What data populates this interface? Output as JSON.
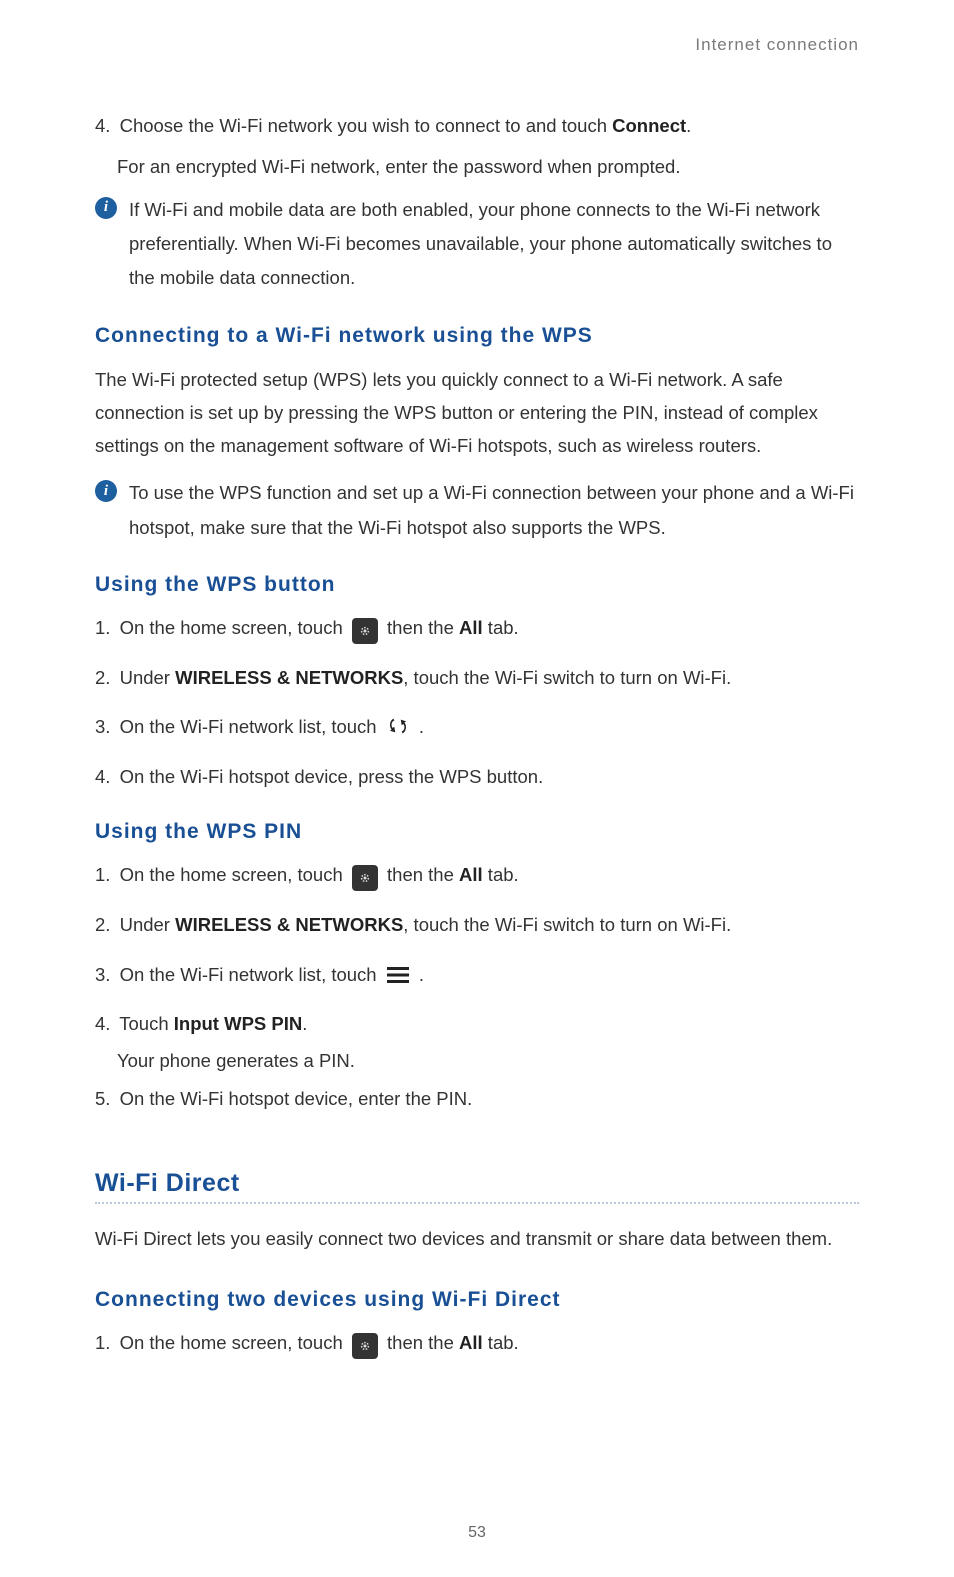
{
  "header": {
    "title": "Internet connection"
  },
  "intro": {
    "step4_num": "4.",
    "step4_text_a": "Choose the Wi-Fi network you wish to connect to and touch ",
    "step4_bold": "Connect",
    "step4_text_b": ".",
    "step4_sub": "For an encrypted Wi-Fi network, enter the password when prompted.",
    "info_text": "If Wi-Fi and mobile data are both enabled, your phone connects to the Wi-Fi network preferentially. When Wi-Fi becomes unavailable, your phone automatically switches to the mobile data connection."
  },
  "wps_connect": {
    "title": "Connecting to a Wi-Fi network using the WPS",
    "para": "The Wi-Fi protected setup (WPS) lets you quickly connect to a Wi-Fi network. A safe connection is set up by pressing the WPS button or entering the PIN, instead of complex settings on the management software of Wi-Fi hotspots, such as wireless routers.",
    "info_text": "To use the WPS function and set up a Wi-Fi connection between your phone and a Wi-Fi hotspot, make sure that the Wi-Fi hotspot also supports the WPS."
  },
  "wps_button": {
    "title": "Using the WPS button",
    "s1_num": "1.",
    "s1_a": "On the home screen, touch ",
    "s1_b": " then the ",
    "s1_bold": "All",
    "s1_c": " tab.",
    "s2_num": "2.",
    "s2_a": "Under ",
    "s2_bold": "WIRELESS & NETWORKS",
    "s2_b": ", touch the Wi-Fi switch to turn on Wi-Fi.",
    "s3_num": "3.",
    "s3_a": "On the Wi-Fi network list, touch ",
    "s3_b": " .",
    "s4_num": "4.",
    "s4_a": "On the Wi-Fi hotspot device, press the WPS button."
  },
  "wps_pin": {
    "title": "Using the WPS PIN",
    "s1_num": "1.",
    "s1_a": "On the home screen, touch ",
    "s1_b": " then the ",
    "s1_bold": "All",
    "s1_c": " tab.",
    "s2_num": "2.",
    "s2_a": "Under ",
    "s2_bold": "WIRELESS & NETWORKS",
    "s2_b": ", touch the Wi-Fi switch to turn on Wi-Fi.",
    "s3_num": "3.",
    "s3_a": "On the Wi-Fi network list, touch ",
    "s3_b": " .",
    "s4_num": "4.",
    "s4_a": "Touch ",
    "s4_bold": "Input WPS PIN",
    "s4_b": ".",
    "s4_sub": "Your phone generates a PIN.",
    "s5_num": "5.",
    "s5_a": "On the Wi-Fi hotspot device, enter the PIN."
  },
  "wifi_direct": {
    "title": "Wi-Fi Direct",
    "para": "Wi-Fi Direct lets you easily connect two devices and transmit or share data between them.",
    "sub_title": "Connecting two devices using Wi-Fi Direct",
    "s1_num": "1.",
    "s1_a": "On the home screen, touch ",
    "s1_b": " then the ",
    "s1_bold": "All",
    "s1_c": " tab."
  },
  "footer": {
    "page_no": "53"
  }
}
